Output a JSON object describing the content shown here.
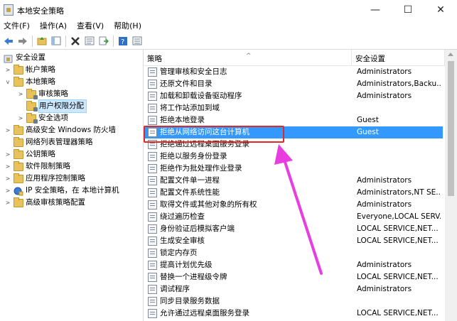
{
  "window": {
    "title": "本地安全策略",
    "controls": {
      "minimize": "—",
      "maximize": "☐",
      "close": "✕"
    }
  },
  "menu": [
    {
      "label": "文件(F)"
    },
    {
      "label": "操作(A)"
    },
    {
      "label": "查看(V)"
    },
    {
      "label": "帮助(H)"
    }
  ],
  "toolbar": {
    "icons": [
      "back-icon",
      "forward-icon",
      "up-folder-icon",
      "show-hide-tree-icon",
      "delete-icon",
      "properties-icon",
      "export-list-icon",
      "help-icon",
      "view-icon"
    ]
  },
  "tree": [
    {
      "label": "安全设置",
      "level": 0,
      "expander": "",
      "icon": "security-settings-icon"
    },
    {
      "label": "帐户策略",
      "level": 1,
      "expander": ">",
      "icon": "folder-icon"
    },
    {
      "label": "本地策略",
      "level": 1,
      "expander": "v",
      "icon": "folder-icon"
    },
    {
      "label": "审核策略",
      "level": 2,
      "expander": ">",
      "icon": "folder-icon"
    },
    {
      "label": "用户权限分配",
      "level": 2,
      "expander": "",
      "icon": "folder-icon",
      "selected": true
    },
    {
      "label": "安全选项",
      "level": 2,
      "expander": ">",
      "icon": "folder-icon"
    },
    {
      "label": "高级安全 Windows 防火墙",
      "level": 1,
      "expander": ">",
      "icon": "folder-icon"
    },
    {
      "label": "网络列表管理器策略",
      "level": 1,
      "expander": "",
      "icon": "folder-icon"
    },
    {
      "label": "公钥策略",
      "level": 1,
      "expander": ">",
      "icon": "folder-icon"
    },
    {
      "label": "软件限制策略",
      "level": 1,
      "expander": ">",
      "icon": "folder-icon"
    },
    {
      "label": "应用程序控制策略",
      "level": 1,
      "expander": ">",
      "icon": "folder-icon"
    },
    {
      "label": "IP 安全策略，在 本地计算机",
      "level": 1,
      "expander": ">",
      "icon": "ip-security-icon"
    },
    {
      "label": "高级审核策略配置",
      "level": 1,
      "expander": ">",
      "icon": "folder-icon"
    }
  ],
  "list": {
    "columns": {
      "policy": "策略",
      "setting": "安全设置",
      "sort_indicator": "^"
    },
    "rows": [
      {
        "policy": "管理审核和安全日志",
        "setting": "Administrators"
      },
      {
        "policy": "还原文件和目录",
        "setting": "Administrators,Backu..."
      },
      {
        "policy": "加载和卸载设备驱动程序",
        "setting": "Administrators"
      },
      {
        "policy": "将工作站添加到域",
        "setting": ""
      },
      {
        "policy": "拒绝本地登录",
        "setting": "Guest"
      },
      {
        "policy": "拒绝从网络访问这台计算机",
        "setting": "Guest",
        "selected": true
      },
      {
        "policy": "拒绝通过远程桌面服务登录",
        "setting": ""
      },
      {
        "policy": "拒绝以服务身份登录",
        "setting": ""
      },
      {
        "policy": "拒绝作为批处理作业登录",
        "setting": ""
      },
      {
        "policy": "配置文件单一进程",
        "setting": "Administrators"
      },
      {
        "policy": "配置文件系统性能",
        "setting": "Administrators,NT SE..."
      },
      {
        "policy": "取得文件或其他对象的所有权",
        "setting": "Administrators"
      },
      {
        "policy": "绕过遍历检查",
        "setting": "Everyone,LOCAL SERV..."
      },
      {
        "policy": "身份验证后模拟客户端",
        "setting": "LOCAL SERVICE,NET..."
      },
      {
        "policy": "生成安全审核",
        "setting": "LOCAL SERVICE,NET..."
      },
      {
        "policy": "锁定内存页",
        "setting": ""
      },
      {
        "policy": "提高计划优先级",
        "setting": "Administrators"
      },
      {
        "policy": "替换一个进程级令牌",
        "setting": "LOCAL SERVICE,NET..."
      },
      {
        "policy": "调试程序",
        "setting": "Administrators"
      },
      {
        "policy": "同步目录服务数据",
        "setting": ""
      },
      {
        "policy": "允许通过远程桌面服务登录",
        "setting": "LOCAL SERVICE,NET..."
      }
    ]
  },
  "annotation": {
    "highlight_color": "#e02a2a",
    "arrow_color": "#e83ee0"
  }
}
